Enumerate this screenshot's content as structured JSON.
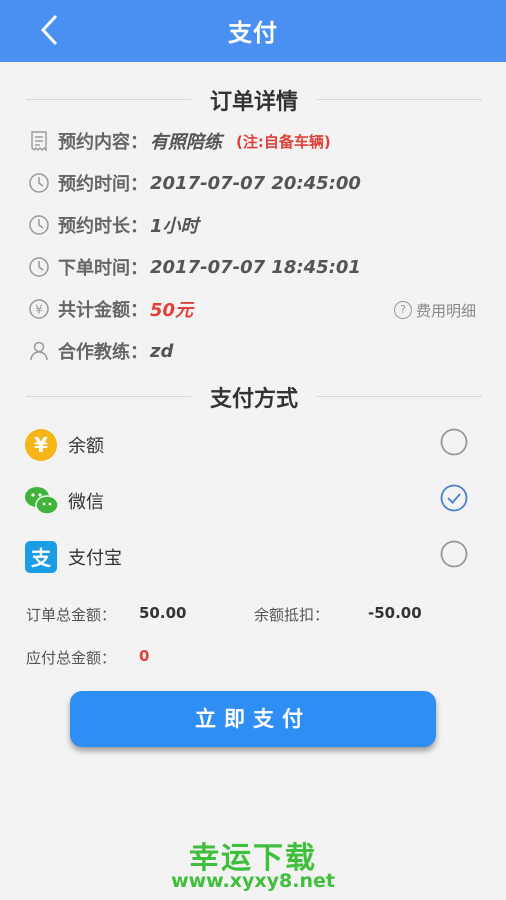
{
  "header": {
    "title": "支付"
  },
  "order": {
    "section_title": "订单详情",
    "content_label": "预约内容：",
    "content_value": "有照陪练",
    "content_note": "(注:自备车辆)",
    "time_label": "预约时间：",
    "time_value": "2017-07-07 20:45:00",
    "duration_label": "预约时长：",
    "duration_value": "1小时",
    "order_time_label": "下单时间：",
    "order_time_value": "2017-07-07 18:45:01",
    "total_label": "共计金额：",
    "total_value": "50元",
    "fee_detail": "费用明细",
    "coach_label": "合作教练：",
    "coach_value": "zd"
  },
  "payment": {
    "section_title": "支付方式",
    "options": [
      {
        "label": "余额",
        "selected": false,
        "icon": "yen-coin-icon",
        "color": "#f6b619"
      },
      {
        "label": "微信",
        "selected": true,
        "icon": "wechat-icon",
        "color": "#3fb33a"
      },
      {
        "label": "支付宝",
        "selected": false,
        "icon": "alipay-icon",
        "color": "#1a9ce6"
      }
    ]
  },
  "summary": {
    "order_total_label": "订单总金额：",
    "order_total_value": "50.00",
    "balance_deduct_label": "余额抵扣：",
    "balance_deduct_value": "-50.00",
    "payable_label": "应付总金额：",
    "payable_value": "0"
  },
  "pay_button": "立即支付",
  "watermark": {
    "title": "幸运下载",
    "url": "www.xyxy8.net"
  },
  "colors": {
    "header": "#4a8ff2",
    "button": "#2f8ef4",
    "red": "#e0413b",
    "watermark": "#3fbf3c"
  }
}
